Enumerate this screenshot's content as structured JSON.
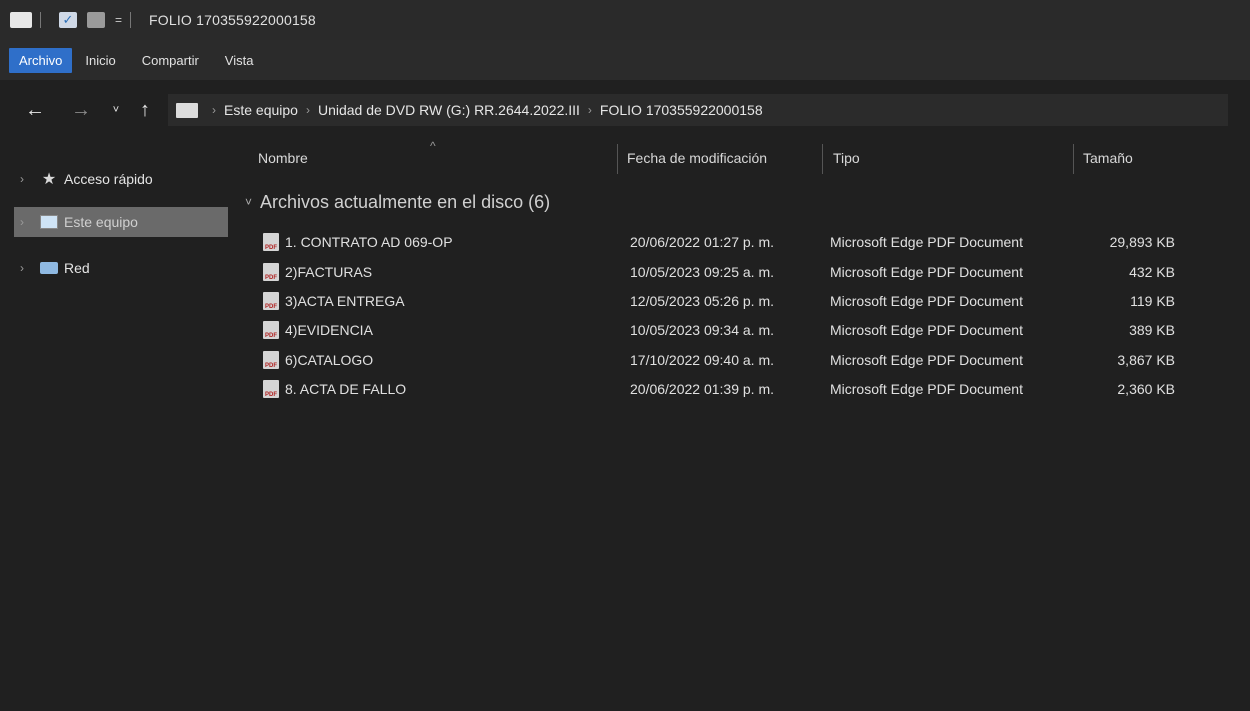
{
  "window": {
    "title": "FOLIO 170355922000158"
  },
  "ribbon": {
    "tabs": [
      "Archivo",
      "Inicio",
      "Compartir",
      "Vista"
    ],
    "active_color": "#2f6fc9"
  },
  "quick_access": {
    "dropdown_glyph": "="
  },
  "nav": {
    "back": "←",
    "forward": "→",
    "recent": "˅",
    "up": "↑"
  },
  "address": {
    "crumbs": [
      "Este equipo",
      "Unidad de DVD RW (G:) RR.2644.2022.III",
      "FOLIO 170355922000158"
    ],
    "separator": "›"
  },
  "sidebar": {
    "items": [
      {
        "label": "Acceso rápido",
        "icon": "star-icon"
      },
      {
        "label": "Este equipo",
        "icon": "computer-icon"
      },
      {
        "label": "Red",
        "icon": "network-icon"
      }
    ]
  },
  "columns": {
    "name": "Nombre",
    "date": "Fecha de modificación",
    "type": "Tipo",
    "size": "Tamaño"
  },
  "group": {
    "label": "Archivos actualmente en el disco (6)"
  },
  "files": [
    {
      "name": "1. CONTRATO AD 069-OP",
      "date": "20/06/2022 01:27 p. m.",
      "type": "Microsoft Edge PDF Document",
      "size": "29,893 KB"
    },
    {
      "name": "2)FACTURAS",
      "date": "10/05/2023 09:25 a. m.",
      "type": "Microsoft Edge PDF Document",
      "size": "432 KB"
    },
    {
      "name": "3)ACTA ENTREGA",
      "date": "12/05/2023 05:26 p. m.",
      "type": "Microsoft Edge PDF Document",
      "size": "119 KB"
    },
    {
      "name": "4)EVIDENCIA",
      "date": "10/05/2023 09:34 a. m.",
      "type": "Microsoft Edge PDF Document",
      "size": "389 KB"
    },
    {
      "name": "6)CATALOGO",
      "date": "17/10/2022 09:40 a. m.",
      "type": "Microsoft Edge PDF Document",
      "size": "3,867 KB"
    },
    {
      "name": "8. ACTA DE FALLO",
      "date": "20/06/2022 01:39 p. m.",
      "type": "Microsoft Edge PDF Document",
      "size": "2,360 KB"
    }
  ],
  "pdf_icon_text": "PDF"
}
